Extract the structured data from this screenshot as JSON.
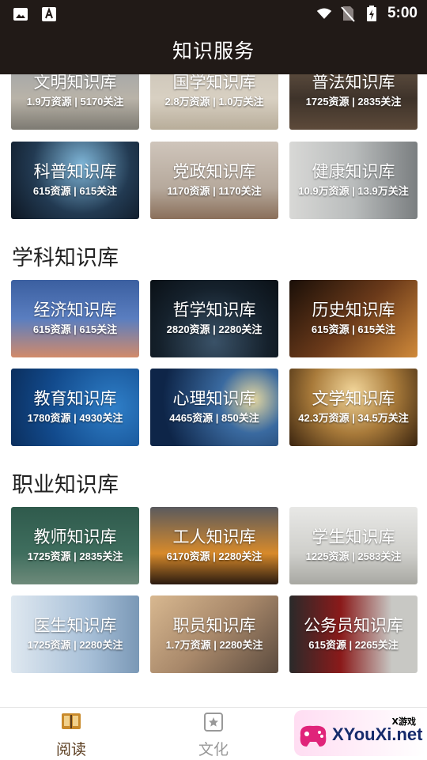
{
  "status_bar": {
    "time": "5:00",
    "icons": [
      "image-icon",
      "text-a-icon",
      "wifi-icon",
      "no-sim-icon",
      "battery-charging-icon"
    ]
  },
  "app_bar": {
    "title": "知识服务"
  },
  "top_rows": [
    [
      {
        "title": "文明知识库",
        "stats": "1.9万资源 | 5170关注"
      },
      {
        "title": "国学知识库",
        "stats": "2.8万资源 | 1.0万关注"
      },
      {
        "title": "普法知识库",
        "stats": "1725资源 | 2835关注"
      }
    ],
    [
      {
        "title": "科普知识库",
        "stats": "615资源 | 615关注"
      },
      {
        "title": "党政知识库",
        "stats": "1170资源 | 1170关注"
      },
      {
        "title": "健康知识库",
        "stats": "10.9万资源 | 13.9万关注"
      }
    ]
  ],
  "sections": [
    {
      "title": "学科知识库",
      "rows": [
        [
          {
            "title": "经济知识库",
            "stats": "615资源 | 615关注"
          },
          {
            "title": "哲学知识库",
            "stats": "2820资源 | 2280关注"
          },
          {
            "title": "历史知识库",
            "stats": "615资源 | 615关注"
          }
        ],
        [
          {
            "title": "教育知识库",
            "stats": "1780资源 | 4930关注"
          },
          {
            "title": "心理知识库",
            "stats": "4465资源 | 850关注"
          },
          {
            "title": "文学知识库",
            "stats": "42.3万资源 | 34.5万关注"
          }
        ]
      ]
    },
    {
      "title": "职业知识库",
      "rows": [
        [
          {
            "title": "教师知识库",
            "stats": "1725资源 | 2835关注"
          },
          {
            "title": "工人知识库",
            "stats": "6170资源 | 2280关注"
          },
          {
            "title": "学生知识库",
            "stats": "1225资源 | 2583关注"
          }
        ],
        [
          {
            "title": "医生知识库",
            "stats": "1725资源 | 2280关注"
          },
          {
            "title": "职员知识库",
            "stats": "1.7万资源 | 2280关注"
          },
          {
            "title": "公务员知识库",
            "stats": "615资源 | 2265关注"
          }
        ]
      ]
    }
  ],
  "bottom_nav": [
    {
      "label": "阅读",
      "icon": "book-icon",
      "active": true
    },
    {
      "label": "文化",
      "icon": "star-square-icon",
      "active": false
    }
  ],
  "watermark": {
    "text": "XYouXi.net",
    "small": "X游戏"
  },
  "colors": {
    "bar": "#211a17",
    "active": "#5a3c1e",
    "inactive": "#999999",
    "active_icon": "#c98a2b"
  }
}
